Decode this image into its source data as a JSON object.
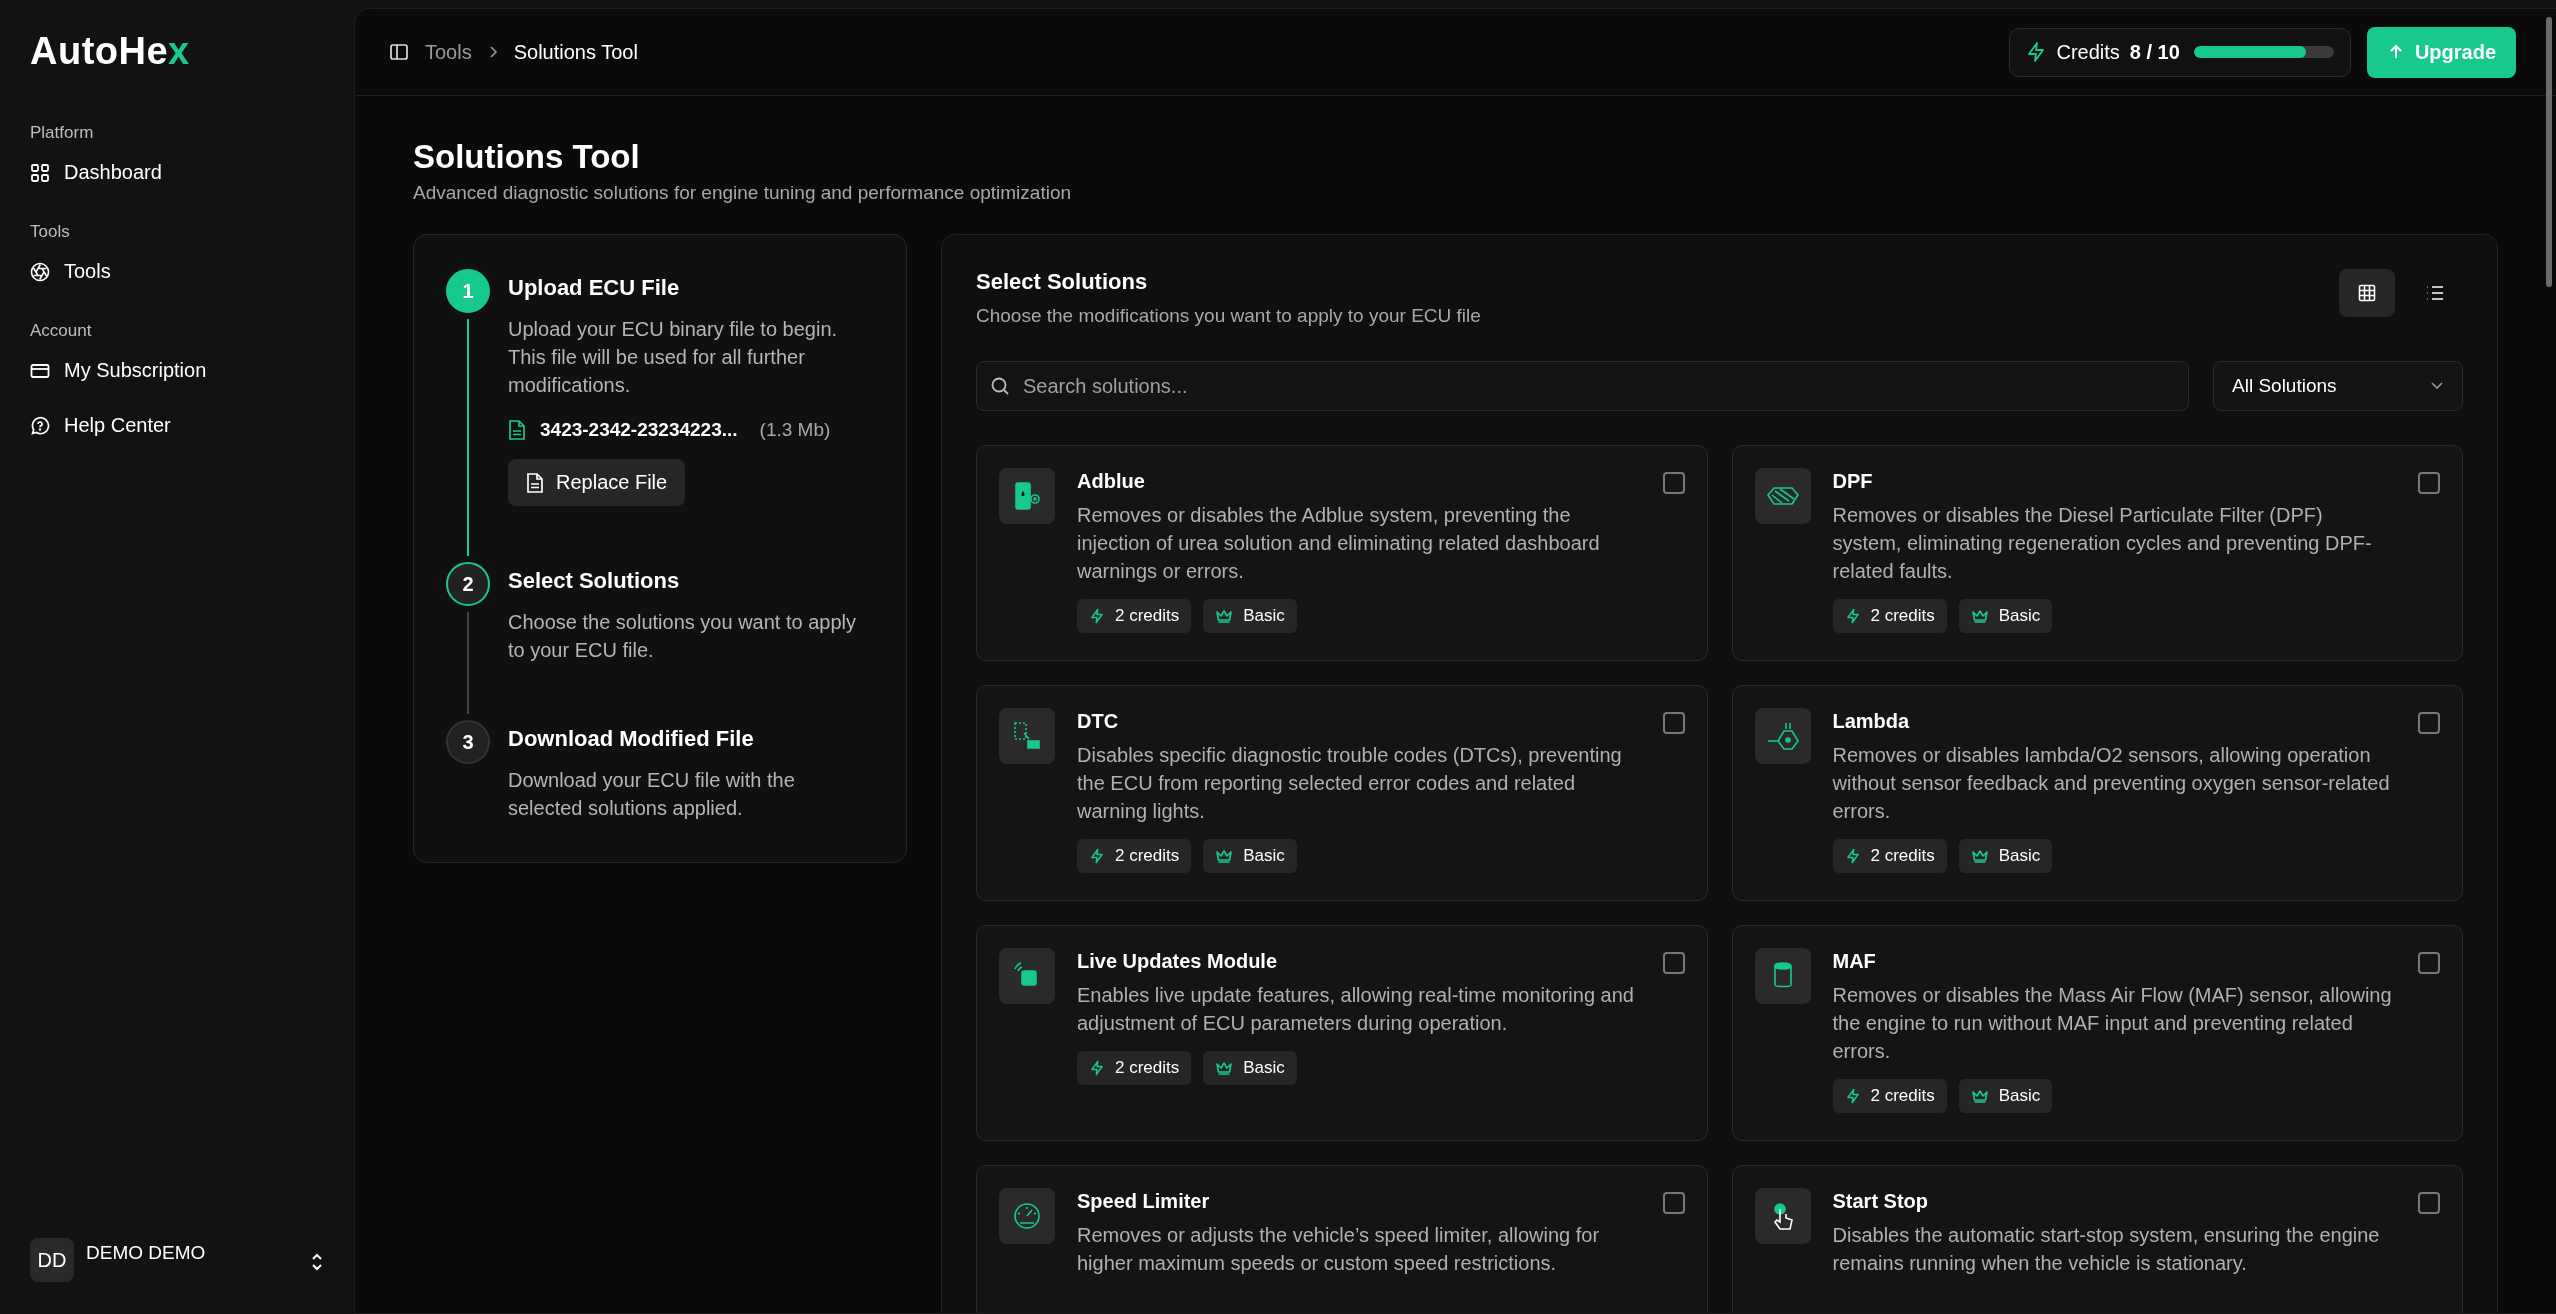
{
  "sidebar": {
    "logo": "AutoHex",
    "sections": [
      {
        "heading": "Platform",
        "items": [
          {
            "label": "Dashboard",
            "selected": false
          }
        ]
      },
      {
        "heading": "Tools",
        "items": [
          {
            "label": "Tools",
            "selected": false
          }
        ]
      },
      {
        "heading": "Account",
        "items": [
          {
            "label": "My Subscription",
            "selected": false
          },
          {
            "label": "Help Center",
            "selected": false
          }
        ]
      }
    ],
    "user": {
      "initials": "DD",
      "name": "DEMO DEMO"
    }
  },
  "header": {
    "breadcrumbs": [
      "Tools",
      "Solutions Tool"
    ],
    "credits": {
      "label": "Credits",
      "reading": "8 / 10",
      "level": 0.8
    },
    "upgrade": "Upgrade"
  },
  "page": {
    "title": "Solutions Tool",
    "subtitle": "Advanced diagnostic solutions for engine tuning and performance optimization"
  },
  "steps": [
    {
      "number": "1",
      "title": "Upload ECU File",
      "done": true,
      "active": false,
      "description": "Upload your ECU binary file to begin. This file will be used for all further modifications.",
      "file": {
        "name": "3423-2342-23234223...",
        "size": "(1.3 Mb)"
      },
      "button": "Replace File"
    },
    {
      "number": "2",
      "title": "Select Solutions",
      "done": false,
      "active": true,
      "description": "Choose the solutions you want to apply to your ECU file."
    },
    {
      "number": "3",
      "title": "Download Modified File",
      "done": false,
      "active": false,
      "description": "Download your ECU file with the selected solutions applied."
    }
  ],
  "solutions": {
    "title": "Select Solutions",
    "subtitle": "Choose the modifications you want to apply to your ECU file",
    "views": [
      {
        "kind": "grid",
        "selected": true
      },
      {
        "kind": "list",
        "selected": false
      }
    ],
    "search": {
      "placeholder": "Search solutions..."
    },
    "filter": "All Solutions",
    "cards": [
      {
        "title": "Adblue",
        "description": "Removes or disables the Adblue system, preventing the injection of urea solution and eliminating related dashboard warnings or errors.",
        "checked": false,
        "credits": "2 credits",
        "tier": "Basic"
      },
      {
        "title": "DPF",
        "description": "Removes or disables the Diesel Particulate Filter (DPF) system, eliminating regeneration cycles and preventing DPF-related faults.",
        "checked": false,
        "credits": "2 credits",
        "tier": "Basic"
      },
      {
        "title": "DTC",
        "description": "Disables specific diagnostic trouble codes (DTCs), preventing the ECU from reporting selected error codes and related warning lights.",
        "checked": false,
        "credits": "2 credits",
        "tier": "Basic"
      },
      {
        "title": "Lambda",
        "description": "Removes or disables lambda/O2 sensors, allowing operation without sensor feedback and preventing oxygen sensor-related errors.",
        "checked": false,
        "credits": "2 credits",
        "tier": "Basic"
      },
      {
        "title": "Live Updates Module",
        "description": "Enables live update features, allowing real-time monitoring and adjustment of ECU parameters during operation.",
        "checked": false,
        "credits": "2 credits",
        "tier": "Basic"
      },
      {
        "title": "MAF",
        "description": "Removes or disables the Mass Air Flow (MAF) sensor, allowing the engine to run without MAF input and preventing related errors.",
        "checked": false,
        "credits": "2 credits",
        "tier": "Basic"
      },
      {
        "title": "Speed Limiter",
        "description": "Removes or adjusts the vehicle’s speed limiter, allowing for higher maximum speeds or custom speed restrictions.",
        "checked": false
      },
      {
        "title": "Start Stop",
        "description": "Disables the automatic start-stop system, ensuring the engine remains running when the vehicle is stationary.",
        "checked": false
      }
    ]
  }
}
